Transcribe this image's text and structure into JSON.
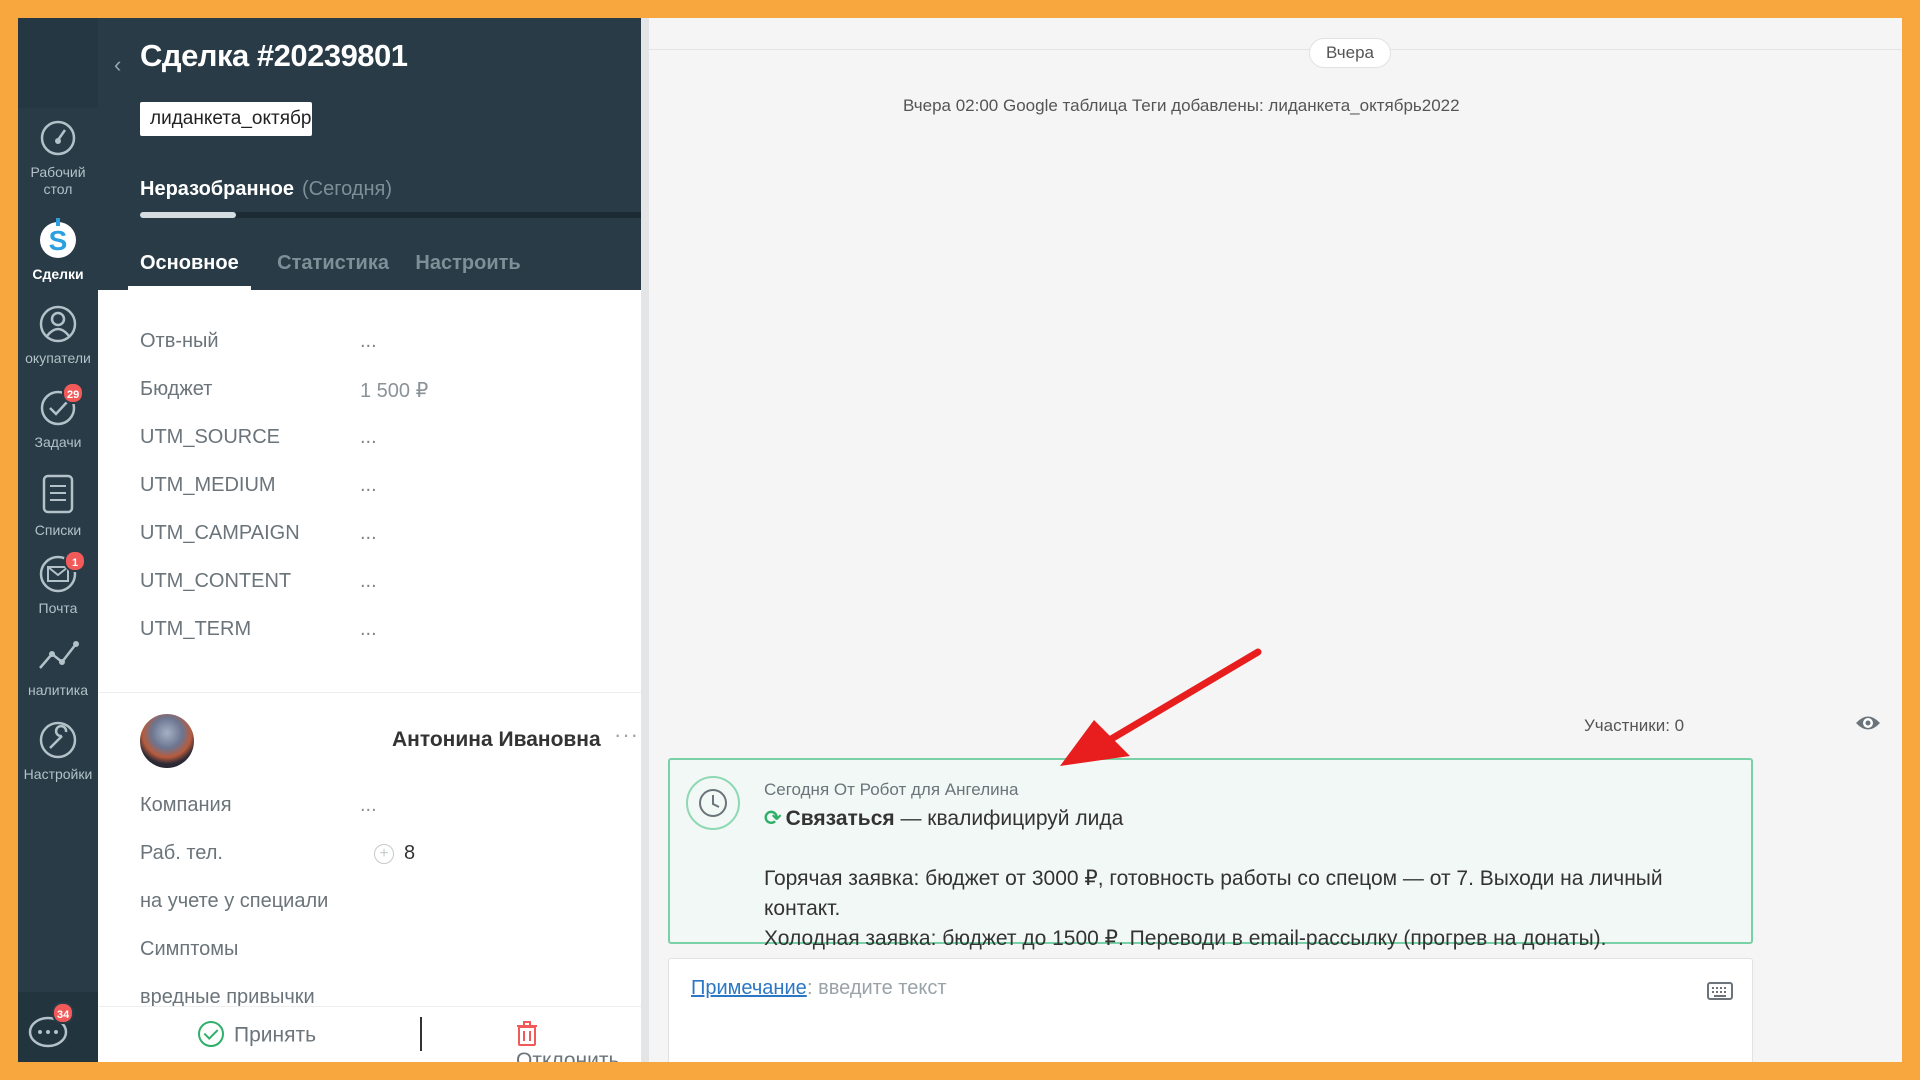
{
  "nav": {
    "items": [
      {
        "label": "Рабочий\nстол",
        "line1": "Рабочий",
        "line2": "стол",
        "icon": "dashboard-icon"
      },
      {
        "label": "Сделки",
        "icon": "deals-dollar-icon"
      },
      {
        "label": "окупатели",
        "icon": "buyers-icon"
      },
      {
        "label": "Задачи",
        "icon": "tasks-check-icon",
        "badge": "29"
      },
      {
        "label": "Списки",
        "icon": "lists-icon"
      },
      {
        "label": "Почта",
        "icon": "mail-icon",
        "badge": "1"
      },
      {
        "label": "налитика",
        "icon": "analytics-icon"
      },
      {
        "label": "Настройки",
        "icon": "settings-wrench-icon"
      }
    ],
    "chat_badge": "34"
  },
  "deal": {
    "title": "Сделка #20239801",
    "more": "···",
    "tag": "лиданкета_октябрь",
    "stage": "Неразобранное",
    "stage_date": "(Сегодня)",
    "tabs": [
      "Основное",
      "Статистика",
      "Настроить"
    ],
    "fields": [
      {
        "label": "Отв-ный",
        "value": "..."
      },
      {
        "label": "Бюджет",
        "value": "1 500  ₽"
      },
      {
        "label": "UTM_SOURCE",
        "value": "..."
      },
      {
        "label": "UTM_MEDIUM",
        "value": "..."
      },
      {
        "label": "UTM_CAMPAIGN",
        "value": "..."
      },
      {
        "label": "UTM_CONTENT",
        "value": "..."
      },
      {
        "label": "UTM_TERM",
        "value": "..."
      }
    ],
    "contact": {
      "name": "Антонина Ивановна",
      "more": "···",
      "fields": [
        {
          "label": "Компания",
          "value": "..."
        },
        {
          "label": "Раб. тел.",
          "value": "8"
        },
        {
          "label": "на учете у специали",
          "value": ""
        },
        {
          "label": "Симптомы",
          "value": ""
        },
        {
          "label": "вредные привычки",
          "value": ""
        }
      ]
    },
    "accept": "Принять",
    "reject": "Отклонить"
  },
  "feed": {
    "day_pill": "Вчера",
    "event": "Вчера 02:00 Google таблица Теги добавлены: лиданкета_октябрь2022",
    "participants": "Участники: 0",
    "task": {
      "meta": "Сегодня От Робот для Ангелина",
      "type": "Связаться",
      "type_rest": " — квалифицируй лида",
      "line1": "Горячая заявка: бюджет от 3000 ₽, готовность работы со спецом — от 7. Выходи на личный контакт.",
      "line2": "Холодная заявка: бюджет до 1500 ₽. Переводи в email-рассылку (прогрев на донаты)."
    },
    "note": {
      "label": "Примечание",
      "placeholder": ": введите текст"
    }
  },
  "colors": {
    "frame": "#f8a63e",
    "rail": "#283b46",
    "accent_green": "#2fb06a",
    "badge_red": "#f25a5a",
    "annotation_arrow": "#e81e1e"
  }
}
